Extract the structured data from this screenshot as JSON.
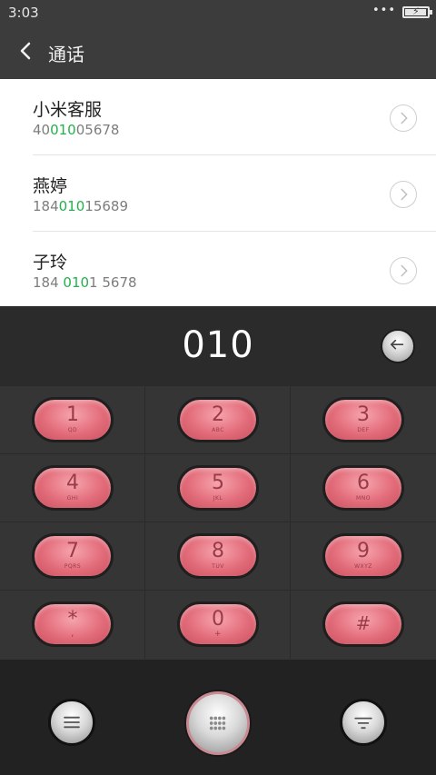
{
  "status": {
    "time": "3:03",
    "dots": "•••"
  },
  "header": {
    "title": "通话"
  },
  "results": [
    {
      "name": "小米客服",
      "pre": "40",
      "match": "010",
      "post": "05678"
    },
    {
      "name": "燕婷",
      "pre": "184",
      "match": "010",
      "post": "15689"
    },
    {
      "name": "子玲",
      "pre": "184 ",
      "match": "010",
      "post": "1 5678"
    }
  ],
  "display": {
    "digits": "010"
  },
  "keys": [
    {
      "digit": "1",
      "letters": "QD"
    },
    {
      "digit": "2",
      "letters": "ABC"
    },
    {
      "digit": "3",
      "letters": "DEF"
    },
    {
      "digit": "4",
      "letters": "GHI"
    },
    {
      "digit": "5",
      "letters": "JKL"
    },
    {
      "digit": "6",
      "letters": "MNO"
    },
    {
      "digit": "7",
      "letters": "PQRS"
    },
    {
      "digit": "8",
      "letters": "TUV"
    },
    {
      "digit": "9",
      "letters": "WXYZ"
    },
    {
      "digit": "*",
      "letters": ","
    },
    {
      "digit": "0",
      "letters": "+"
    },
    {
      "digit": "#",
      "letters": ""
    }
  ],
  "colors": {
    "match": "#22b14c",
    "key": "#e36c7a",
    "header": "#3c3c3c"
  }
}
